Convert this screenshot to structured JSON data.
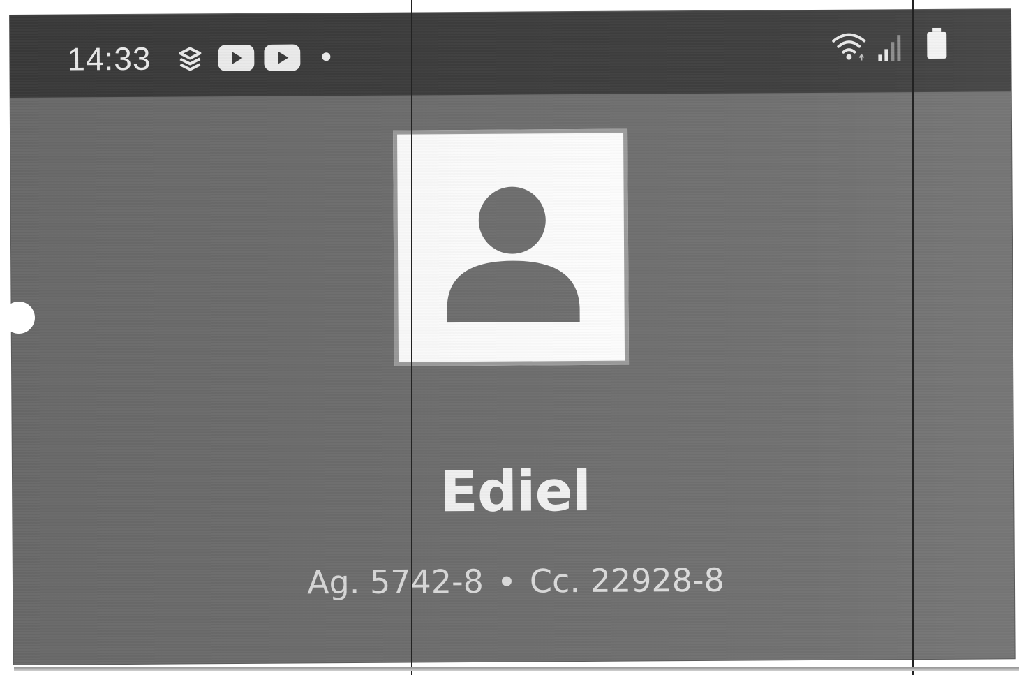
{
  "status_bar": {
    "time": "14:33",
    "left_icons": [
      "bank-app-icon",
      "youtube-icon",
      "youtube-icon",
      "notification-dot-icon"
    ],
    "right_icons": [
      "wifi-icon",
      "signal-icon",
      "battery-icon"
    ]
  },
  "profile": {
    "avatar_icon": "person-icon",
    "name": "Ediel",
    "agency": "Ag. 5742-8",
    "account": "Cc. 22928-8"
  },
  "colors": {
    "status_bar_bg": "#3c3c3c",
    "screen_bg": "#6e6e6e",
    "text": "#f4f4f4",
    "avatar_bg": "#ffffff"
  }
}
